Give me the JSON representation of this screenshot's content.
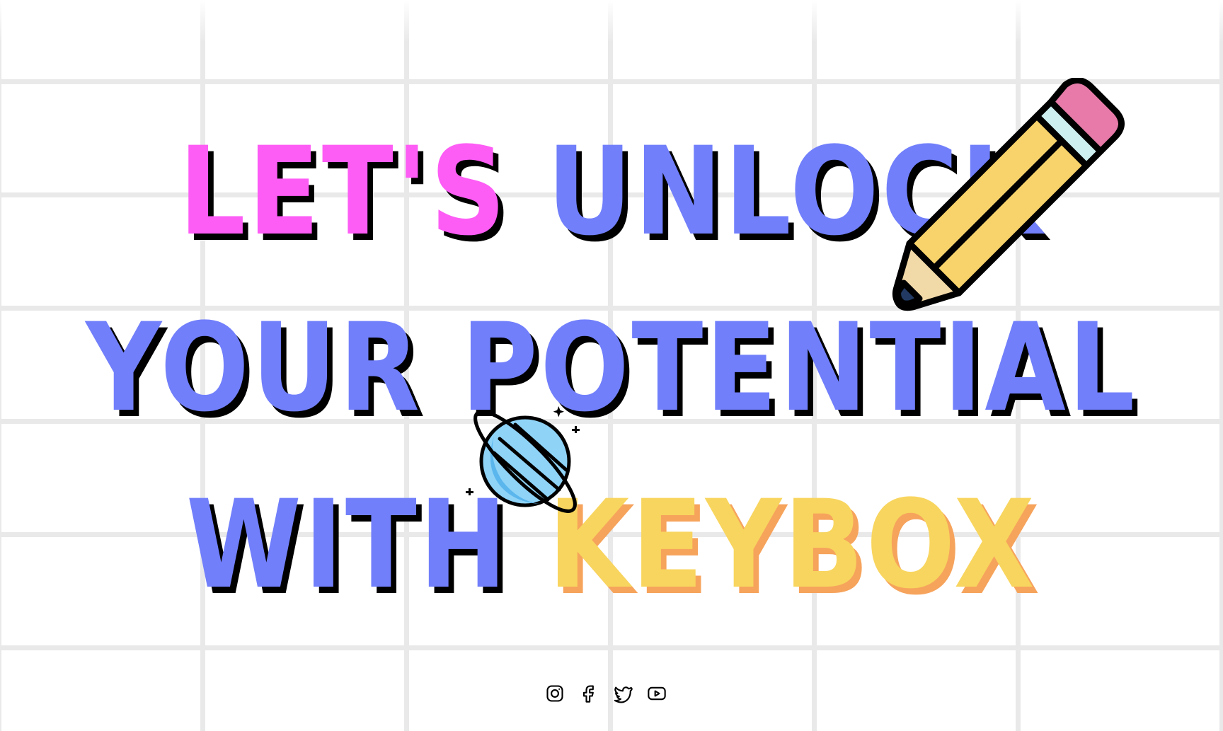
{
  "headline": {
    "line1": {
      "word1": "LET'S",
      "word2": "UNLOCK"
    },
    "line2": {
      "word1": "YOUR",
      "word2": "POTENTIAL"
    },
    "line3": {
      "word1": "WITH",
      "word2": "KEYBOX"
    }
  },
  "colors": {
    "pink": "#fd5cf5",
    "blue": "#717ffb",
    "yellow": "#f8d55e",
    "orange_shadow": "#f6a35c",
    "black_shadow": "#000000",
    "grid": "#e9e9e9"
  },
  "illustrations": [
    "pencil-icon",
    "planet-icon"
  ],
  "social_links": [
    {
      "icon": "instagram-icon"
    },
    {
      "icon": "facebook-icon"
    },
    {
      "icon": "twitter-icon"
    },
    {
      "icon": "youtube-icon"
    }
  ]
}
